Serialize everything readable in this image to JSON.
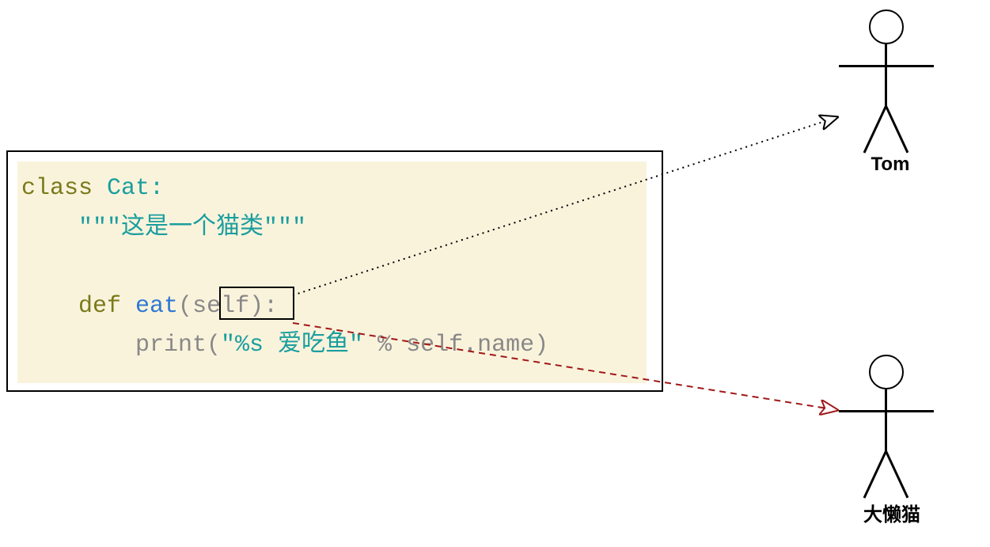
{
  "code": {
    "line1_class": "class",
    "line1_name": "Cat",
    "line1_colon": ":",
    "line2_doc": "\"\"\"这是一个猫类\"\"\"",
    "line3_def": "def",
    "line3_name": "eat",
    "line3_lparen": "(",
    "line3_self": "self",
    "line3_rparen_colon": "):",
    "line4_print": "print",
    "line4_lparen": "(",
    "line4_string": "\"%s 爱吃鱼\"",
    "line4_percent": " % ",
    "line4_self": "self",
    "line4_dot": ".",
    "line4_attr": "name",
    "line4_rparen": ")"
  },
  "figures": {
    "top_label": "Tom",
    "bottom_label": "大懒猫"
  }
}
